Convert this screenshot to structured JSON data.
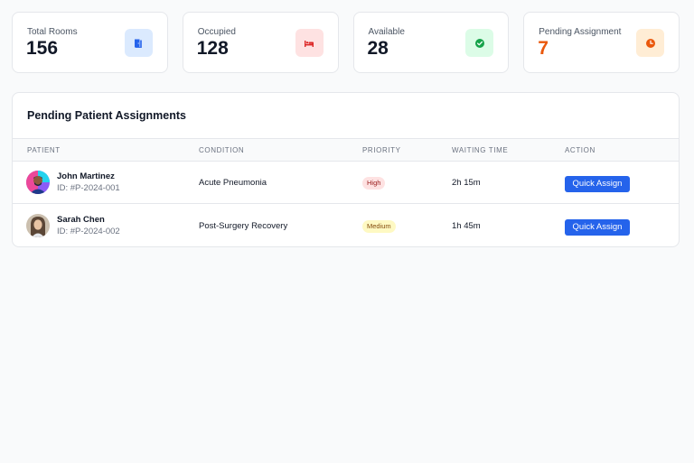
{
  "stats": [
    {
      "label": "Total Rooms",
      "value": "156",
      "icon": "door-icon",
      "icon_bg": "#dbeafe",
      "icon_color": "#2563eb"
    },
    {
      "label": "Occupied",
      "value": "128",
      "icon": "bed-icon",
      "icon_bg": "#fee2e2",
      "icon_color": "#dc2626"
    },
    {
      "label": "Available",
      "value": "28",
      "icon": "check-circle-icon",
      "icon_bg": "#dcfce7",
      "icon_color": "#16a34a"
    },
    {
      "label": "Pending Assignment",
      "value": "7",
      "icon": "clock-icon",
      "icon_bg": "#ffedd5",
      "icon_color": "#ea580c",
      "value_color": "#ea580c"
    }
  ],
  "assignments": {
    "title": "Pending Patient Assignments",
    "columns": [
      "Patient",
      "Condition",
      "Priority",
      "Waiting Time",
      "Action"
    ],
    "rows": [
      {
        "name": "John Martinez",
        "id": "ID: #P-2024-001",
        "condition": "Acute Pneumonia",
        "priority": "High",
        "waiting": "2h 15m",
        "action": "Quick Assign"
      },
      {
        "name": "Sarah Chen",
        "id": "ID: #P-2024-002",
        "condition": "Post-Surgery Recovery",
        "priority": "Medium",
        "waiting": "1h 45m",
        "action": "Quick Assign"
      }
    ]
  },
  "colors": {
    "accent": "#2563eb",
    "priority_high_bg": "#fee2e2",
    "priority_high_text": "#991b1b",
    "priority_medium_bg": "#fef9c3",
    "priority_medium_text": "#854d0e"
  }
}
